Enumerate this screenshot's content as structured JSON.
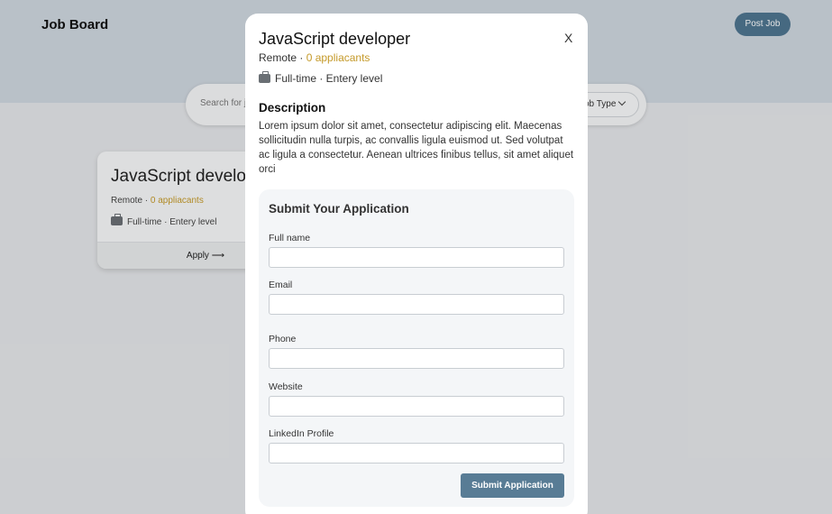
{
  "header": {
    "brand": "Job Board",
    "post_job_label": "Post Job"
  },
  "search": {
    "placeholder": "Search for j",
    "job_type_label": "ob Type"
  },
  "job_card": {
    "title": "JavaScript develop",
    "location": "Remote",
    "separator": " · ",
    "applicants": "0 appliacants",
    "type_line": "Full-time · Entery level",
    "apply_label": "Apply ⟶"
  },
  "modal": {
    "title": "JavaScript developer",
    "close_label": "X",
    "location": "Remote",
    "separator": " · ",
    "applicants": "0 appliacants",
    "type_line": "Full-time · Entery level",
    "description_heading": "Description",
    "description": "Lorem ipsum dolor sit amet, consectetur adipiscing elit. Maecenas sollicitudin nulla turpis, ac convallis ligula euismod ut. Sed volutpat ac ligula a consectetur. Aenean ultrices finibus tellus, sit amet aliquet orci",
    "form": {
      "title": "Submit Your Application",
      "fields": [
        {
          "label": "Full name",
          "value": ""
        },
        {
          "label": "Email",
          "value": ""
        },
        {
          "label": "Phone",
          "value": ""
        },
        {
          "label": "Website",
          "value": ""
        },
        {
          "label": "LinkedIn Profile",
          "value": ""
        }
      ],
      "submit_label": "Submit Application"
    }
  },
  "colors": {
    "accent": "#587c95",
    "applicants": "#c59a2a",
    "hero": "#cfd7df"
  }
}
